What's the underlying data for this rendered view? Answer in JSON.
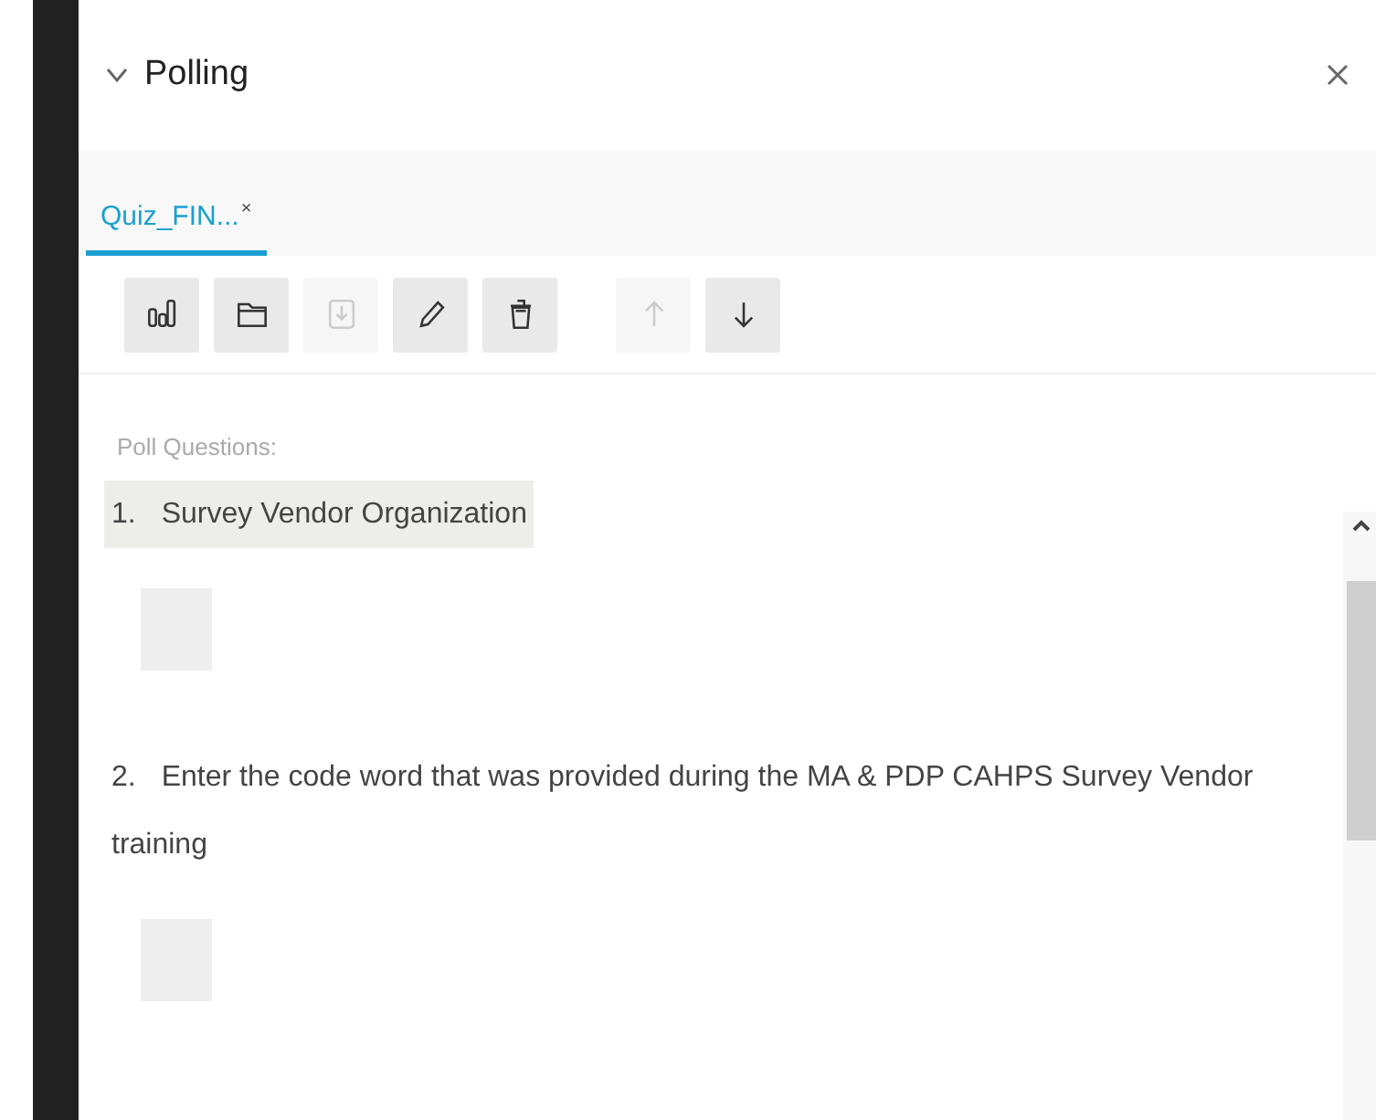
{
  "panel": {
    "title": "Polling",
    "expanded": true
  },
  "tabs": [
    {
      "label": "Quiz_FIN...",
      "close": "×",
      "selected": true
    }
  ],
  "toolbar": [
    {
      "kind": "chart",
      "disabled": false
    },
    {
      "kind": "folder",
      "disabled": false
    },
    {
      "kind": "download",
      "disabled": true
    },
    {
      "kind": "pencil",
      "disabled": false
    },
    {
      "kind": "trash",
      "disabled": false
    },
    {
      "kind": "up",
      "disabled": true
    },
    {
      "kind": "down",
      "disabled": false
    }
  ],
  "section_label": "Poll Questions:",
  "questions": [
    {
      "number": "1.",
      "text": "Survey Vendor Organization",
      "selected": true
    },
    {
      "number": "2.",
      "text": "Enter the code word that was provided during the MA & PDP CAHPS Survey Vendor training",
      "selected": false
    }
  ]
}
